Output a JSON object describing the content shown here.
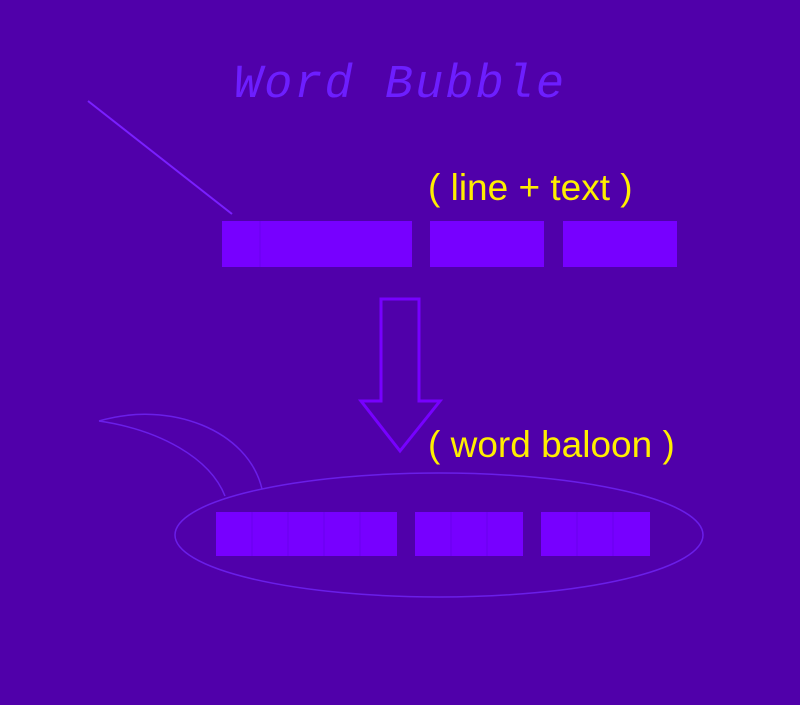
{
  "title": "Word Bubble",
  "labels": {
    "top": "( line + text )",
    "bottom": "( word baloon )"
  },
  "colors": {
    "background": "#5000aa",
    "block_fill": "#7700ff",
    "line_stroke": "#7a1fff",
    "outline_stroke": "#6a1ee8",
    "label_color": "#ffee00",
    "title_color": "#6d1eff"
  }
}
